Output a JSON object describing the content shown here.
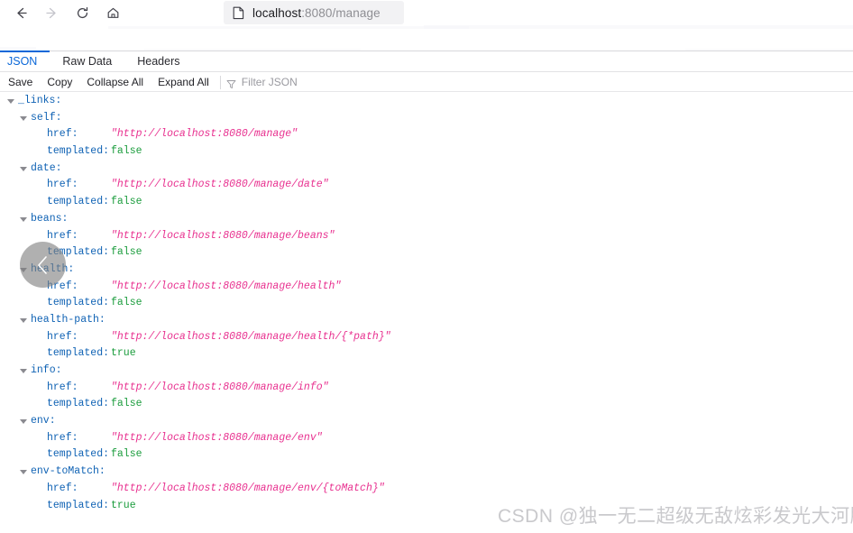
{
  "browser": {
    "nav": {
      "back_icon": "arrow-left-icon",
      "forward_icon": "arrow-right-icon",
      "reload_icon": "reload-icon",
      "home_icon": "home-icon"
    },
    "address_bar": {
      "page_icon": "page-document-icon",
      "host": "localhost",
      "rest": ":8080/manage",
      "full_url": "localhost:8080/manage"
    }
  },
  "viewer": {
    "tabs": [
      {
        "label": "JSON",
        "active": true
      },
      {
        "label": "Raw Data",
        "active": false
      },
      {
        "label": "Headers",
        "active": false
      }
    ],
    "toolbar": {
      "save_label": "Save",
      "copy_label": "Copy",
      "collapse_all_label": "Collapse All",
      "expand_all_label": "Expand All",
      "filter_icon": "filter-funnel-icon",
      "filter_placeholder": "Filter JSON"
    },
    "colors": {
      "accent": "#0a67d8",
      "key": "#0f62b4",
      "string": "#e8308f",
      "boolean": "#1a9c3c"
    }
  },
  "json_tree": {
    "root_label": "_links:",
    "entries": [
      {
        "name": "self:",
        "href_key": "href:",
        "href_value": "\"http://localhost:8080/manage\"",
        "templated_key": "templated:",
        "templated_value": "false"
      },
      {
        "name": "date:",
        "href_key": "href:",
        "href_value": "\"http://localhost:8080/manage/date\"",
        "templated_key": "templated:",
        "templated_value": "false"
      },
      {
        "name": "beans:",
        "href_key": "href:",
        "href_value": "\"http://localhost:8080/manage/beans\"",
        "templated_key": "templated:",
        "templated_value": "false"
      },
      {
        "name": "health:",
        "href_key": "href:",
        "href_value": "\"http://localhost:8080/manage/health\"",
        "templated_key": "templated:",
        "templated_value": "false"
      },
      {
        "name": "health-path:",
        "href_key": "href:",
        "href_value": "\"http://localhost:8080/manage/health/{*path}\"",
        "templated_key": "templated:",
        "templated_value": "true"
      },
      {
        "name": "info:",
        "href_key": "href:",
        "href_value": "\"http://localhost:8080/manage/info\"",
        "templated_key": "templated:",
        "templated_value": "false"
      },
      {
        "name": "env:",
        "href_key": "href:",
        "href_value": "\"http://localhost:8080/manage/env\"",
        "templated_key": "templated:",
        "templated_value": "false"
      },
      {
        "name": "env-toMatch:",
        "href_key": "href:",
        "href_value": "\"http://localhost:8080/manage/env/{toMatch}\"",
        "templated_key": "templated:",
        "templated_value": "true"
      }
    ]
  },
  "overlay": {
    "collapse_handle_icon": "chevron-left-icon"
  },
  "watermark": {
    "text": "CSDN @独一无二超级无敌炫彩发光大河豚"
  }
}
